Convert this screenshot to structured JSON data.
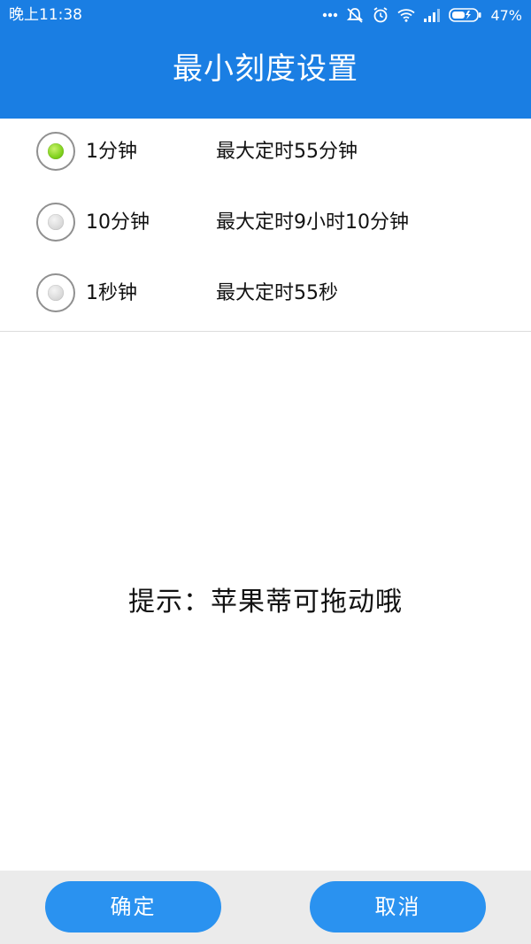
{
  "status_bar": {
    "time": "晚上11:38",
    "battery_percent": "47%",
    "icons": [
      "more-dots-icon",
      "alarm-off-icon",
      "alarm-clock-icon",
      "wifi-icon",
      "signal-icon",
      "battery-icon"
    ]
  },
  "header": {
    "title": "最小刻度设置"
  },
  "options": [
    {
      "label": "1分钟",
      "description": "最大定时55分钟",
      "selected": true
    },
    {
      "label": "10分钟",
      "description": "最大定时9小时10分钟",
      "selected": false
    },
    {
      "label": "1秒钟",
      "description": "最大定时55秒",
      "selected": false
    }
  ],
  "hint": "提示：苹果蒂可拖动哦",
  "buttons": {
    "confirm": "确定",
    "cancel": "取消"
  },
  "colors": {
    "primary": "#1a7ee3",
    "button": "#2a92f0",
    "selected_dot": "#7fd11c",
    "bottom_bar": "#ebebeb"
  }
}
